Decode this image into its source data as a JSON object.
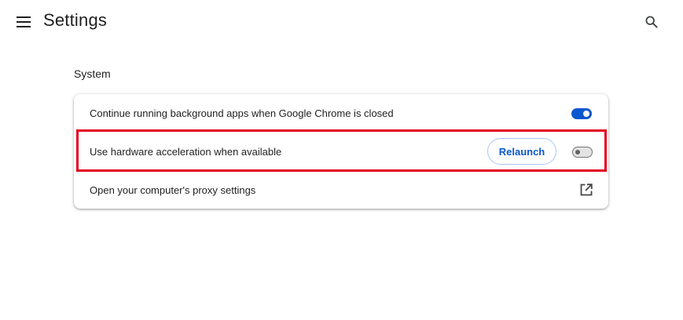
{
  "header": {
    "title": "Settings",
    "menu_icon": "hamburger-menu-icon",
    "search_icon": "search-icon"
  },
  "section": {
    "title": "System"
  },
  "rows": [
    {
      "label": "Continue running background apps when Google Chrome is closed",
      "control": "toggle",
      "enabled": true
    },
    {
      "label": "Use hardware acceleration when available",
      "button_label": "Relaunch",
      "control": "toggle",
      "enabled": false,
      "highlighted": true
    },
    {
      "label": "Open your computer's proxy settings",
      "control": "external-link",
      "icon": "open-in-new-icon"
    }
  ],
  "colors": {
    "accent": "#0b57d0",
    "highlight": "#e3001b",
    "text": "#1f1f1f"
  }
}
